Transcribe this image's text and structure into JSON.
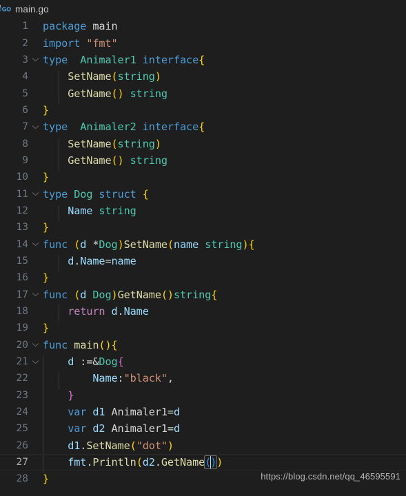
{
  "window": {
    "background_color": "#1e1e1e",
    "active_line_number": 27
  },
  "tab": {
    "icon": "go-gopher-icon",
    "label": "main.go",
    "icon_text": "GO"
  },
  "watermark": {
    "text": "https://blog.csdn.net/qq_46595591"
  },
  "theme": {
    "background": "#1e1e1e",
    "foreground": "#d4d4d4",
    "line_number": "#6e7681",
    "keyword": "#4d9cd6",
    "control_keyword": "#c586c0",
    "type": "#4ec9b0",
    "function": "#dcdcaa",
    "variable": "#9cdcfe",
    "string": "#ce9178",
    "bracket_1": "#ffd700",
    "bracket_2": "#da70d6",
    "bracket_3": "#179fff",
    "indent_guide": "#3b3b3b",
    "active_line_border": "#282828",
    "bracket_match_border": "#6c6c6c"
  },
  "editor": {
    "language": "go",
    "file_name": "main.go",
    "total_lines": 28,
    "lines": [
      {
        "n": 1,
        "text": "package main"
      },
      {
        "n": 2,
        "text": "import \"fmt\""
      },
      {
        "n": 3,
        "text": "type  Animaler1 interface{",
        "fold": "open"
      },
      {
        "n": 4,
        "text": "    SetName(string)"
      },
      {
        "n": 5,
        "text": "    GetName() string"
      },
      {
        "n": 6,
        "text": "}"
      },
      {
        "n": 7,
        "text": "type  Animaler2 interface{",
        "fold": "open"
      },
      {
        "n": 8,
        "text": "    SetName(string)"
      },
      {
        "n": 9,
        "text": "    GetName() string"
      },
      {
        "n": 10,
        "text": "}"
      },
      {
        "n": 11,
        "text": "type Dog struct {",
        "fold": "open"
      },
      {
        "n": 12,
        "text": "    Name string"
      },
      {
        "n": 13,
        "text": "}"
      },
      {
        "n": 14,
        "text": "func (d *Dog)SetName(name string){",
        "fold": "open"
      },
      {
        "n": 15,
        "text": "    d.Name=name"
      },
      {
        "n": 16,
        "text": "}"
      },
      {
        "n": 17,
        "text": "func (d Dog)GetName()string{",
        "fold": "open"
      },
      {
        "n": 18,
        "text": "    return d.Name"
      },
      {
        "n": 19,
        "text": "}"
      },
      {
        "n": 20,
        "text": "func main(){",
        "fold": "open"
      },
      {
        "n": 21,
        "text": "    d :=&Dog{",
        "fold": "open"
      },
      {
        "n": 22,
        "text": "        Name:\"black\","
      },
      {
        "n": 23,
        "text": "    }"
      },
      {
        "n": 24,
        "text": "    var d1 Animaler1=d"
      },
      {
        "n": 25,
        "text": "    var d2 Animaler1=d"
      },
      {
        "n": 26,
        "text": "    d1.SetName(\"dot\")"
      },
      {
        "n": 27,
        "text": "    fmt.Println(d2.GetName())",
        "active": true
      },
      {
        "n": 28,
        "text": "}"
      }
    ]
  }
}
